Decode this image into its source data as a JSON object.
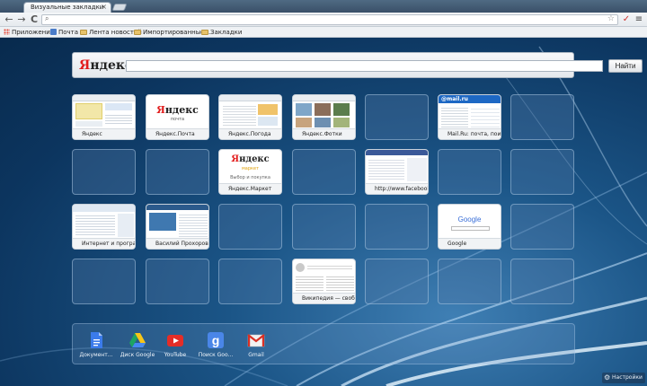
{
  "window": {
    "tab_title": "Визуальные закладки",
    "tab_close": "×"
  },
  "toolbar": {
    "back": "←",
    "forward": "→",
    "reload": "C",
    "omnibox_value": "",
    "star": "☆",
    "extension_icon": "✓",
    "menu_icon": "≡"
  },
  "bookmarks": {
    "items": [
      {
        "label": "Приложения",
        "icon": "apps-grid-icon"
      },
      {
        "label": "Почта",
        "icon": "mail-icon"
      },
      {
        "label": "Лента новостей",
        "icon": "folder-icon"
      },
      {
        "label": "Импортированные...",
        "icon": "folder-icon"
      },
      {
        "label": "Закладки",
        "icon": "folder-icon"
      }
    ]
  },
  "search": {
    "logo": "Яндекс",
    "logo_first": "Я",
    "logo_rest": "ндекс",
    "value": "",
    "button": "Найти"
  },
  "tiles": [
    {
      "row": 0,
      "col": 0,
      "label": "Яндекс",
      "kind": "yandex-home"
    },
    {
      "row": 0,
      "col": 1,
      "label": "Яндекс.Почта",
      "kind": "yandex-mail"
    },
    {
      "row": 0,
      "col": 2,
      "label": "Яндекс.Погода",
      "kind": "page"
    },
    {
      "row": 0,
      "col": 3,
      "label": "Яндекс.Фотки",
      "kind": "photos"
    },
    {
      "row": 0,
      "col": 5,
      "label": "Mail.Ru: почта, поиск",
      "kind": "mailru"
    },
    {
      "row": 1,
      "col": 2,
      "label": "Яндекс.Маркет",
      "kind": "market"
    },
    {
      "row": 1,
      "col": 4,
      "label": "http://www.facebook.com",
      "kind": "facebook"
    },
    {
      "row": 2,
      "col": 0,
      "label": "Интернет и программы",
      "kind": "page"
    },
    {
      "row": 2,
      "col": 1,
      "label": "Василий Прохоров",
      "kind": "video"
    },
    {
      "row": 2,
      "col": 5,
      "label": "Google",
      "kind": "google"
    },
    {
      "row": 3,
      "col": 3,
      "label": "Википедия — свободная",
      "kind": "wiki"
    }
  ],
  "thumb_text": {
    "mail_sub": "почта",
    "market_sub": "маркет",
    "market_caption": "Выбор и покупка",
    "mailru_logo": "@mail.ru",
    "google_logo": "Google"
  },
  "dock": {
    "apps": [
      {
        "label": "Документ...",
        "icon": "google-docs-icon"
      },
      {
        "label": "Диск Google",
        "icon": "google-drive-icon"
      },
      {
        "label": "YouTube",
        "icon": "youtube-icon"
      },
      {
        "label": "Поиск Goo...",
        "icon": "google-search-icon"
      },
      {
        "label": "Gmail",
        "icon": "gmail-icon"
      }
    ]
  },
  "settings": {
    "label": "Настройки",
    "icon": "gear-icon"
  },
  "colors": {
    "yandex_red": "#e21b1b",
    "background": "#0e3a63",
    "tile_empty": "rgba(80,120,165,0.35)"
  }
}
